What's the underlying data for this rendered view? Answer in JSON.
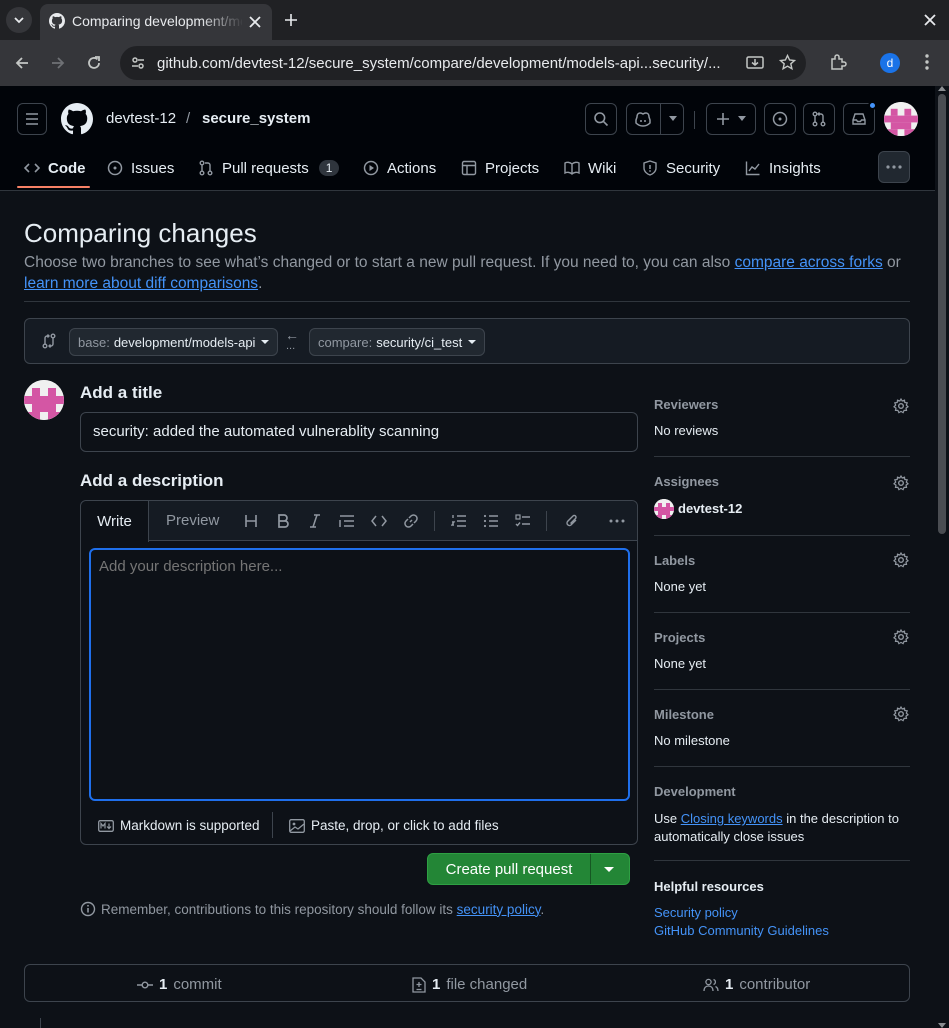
{
  "browser": {
    "tab_title": "Comparing development/models-api...security/ci_test",
    "url": "github.com/devtest-12/secure_system/compare/development/models-api...security/...",
    "profile_initial": "d"
  },
  "header": {
    "owner": "devtest-12",
    "separator": "/",
    "repo": "secure_system"
  },
  "repo_nav": [
    {
      "label": "Code",
      "icon": "code-icon"
    },
    {
      "label": "Issues",
      "icon": "issue-icon"
    },
    {
      "label": "Pull requests",
      "icon": "pull-request-icon",
      "count": "1"
    },
    {
      "label": "Actions",
      "icon": "play-icon"
    },
    {
      "label": "Projects",
      "icon": "table-icon"
    },
    {
      "label": "Wiki",
      "icon": "book-icon"
    },
    {
      "label": "Security",
      "icon": "shield-icon"
    },
    {
      "label": "Insights",
      "icon": "graph-icon"
    }
  ],
  "page": {
    "title": "Comparing changes",
    "subtitle_text": "Choose two branches to see what’s changed or to start a new pull request. If you need to, you can also ",
    "link_compare_forks": "compare across forks",
    "subtitle_or": " or ",
    "link_learn_more": "learn more about diff comparisons",
    "subtitle_end": "."
  },
  "range": {
    "base_prefix": "base:",
    "base_branch": "development/models-api",
    "compare_prefix": "compare:",
    "compare_branch": "security/ci_test",
    "arrow": "←",
    "dots": "..."
  },
  "form": {
    "title_label": "Add a title",
    "title_value": "security: added the automated vulnerablity scanning",
    "description_label": "Add a description",
    "tab_write": "Write",
    "tab_preview": "Preview",
    "description_placeholder": "Add your description here...",
    "markdown_note": "Markdown is supported",
    "files_note": "Paste, drop, or click to add files",
    "create_button": "Create pull request",
    "notice_text": "Remember, contributions to this repository should follow its ",
    "notice_link": "security policy",
    "notice_end": "."
  },
  "sidebar": {
    "reviewers": {
      "heading": "Reviewers",
      "value": "No reviews"
    },
    "assignees": {
      "heading": "Assignees",
      "value": "devtest-12"
    },
    "labels": {
      "heading": "Labels",
      "value": "None yet"
    },
    "projects": {
      "heading": "Projects",
      "value": "None yet"
    },
    "milestone": {
      "heading": "Milestone",
      "value": "No milestone"
    },
    "development": {
      "heading": "Development",
      "text_before": "Use ",
      "link": "Closing keywords",
      "text_after": " in the description to automatically close issues"
    },
    "helpful": {
      "heading": "Helpful resources",
      "link1": "Security policy",
      "link2": "GitHub Community Guidelines"
    }
  },
  "stats": {
    "commits_count": "1",
    "commits_label": "commit",
    "files_count": "1",
    "files_label": "file changed",
    "contributors_count": "1",
    "contributors_label": "contributor"
  },
  "colors": {
    "accent": "#4493f8",
    "create_green": "#238636",
    "background": "#0d1117"
  }
}
